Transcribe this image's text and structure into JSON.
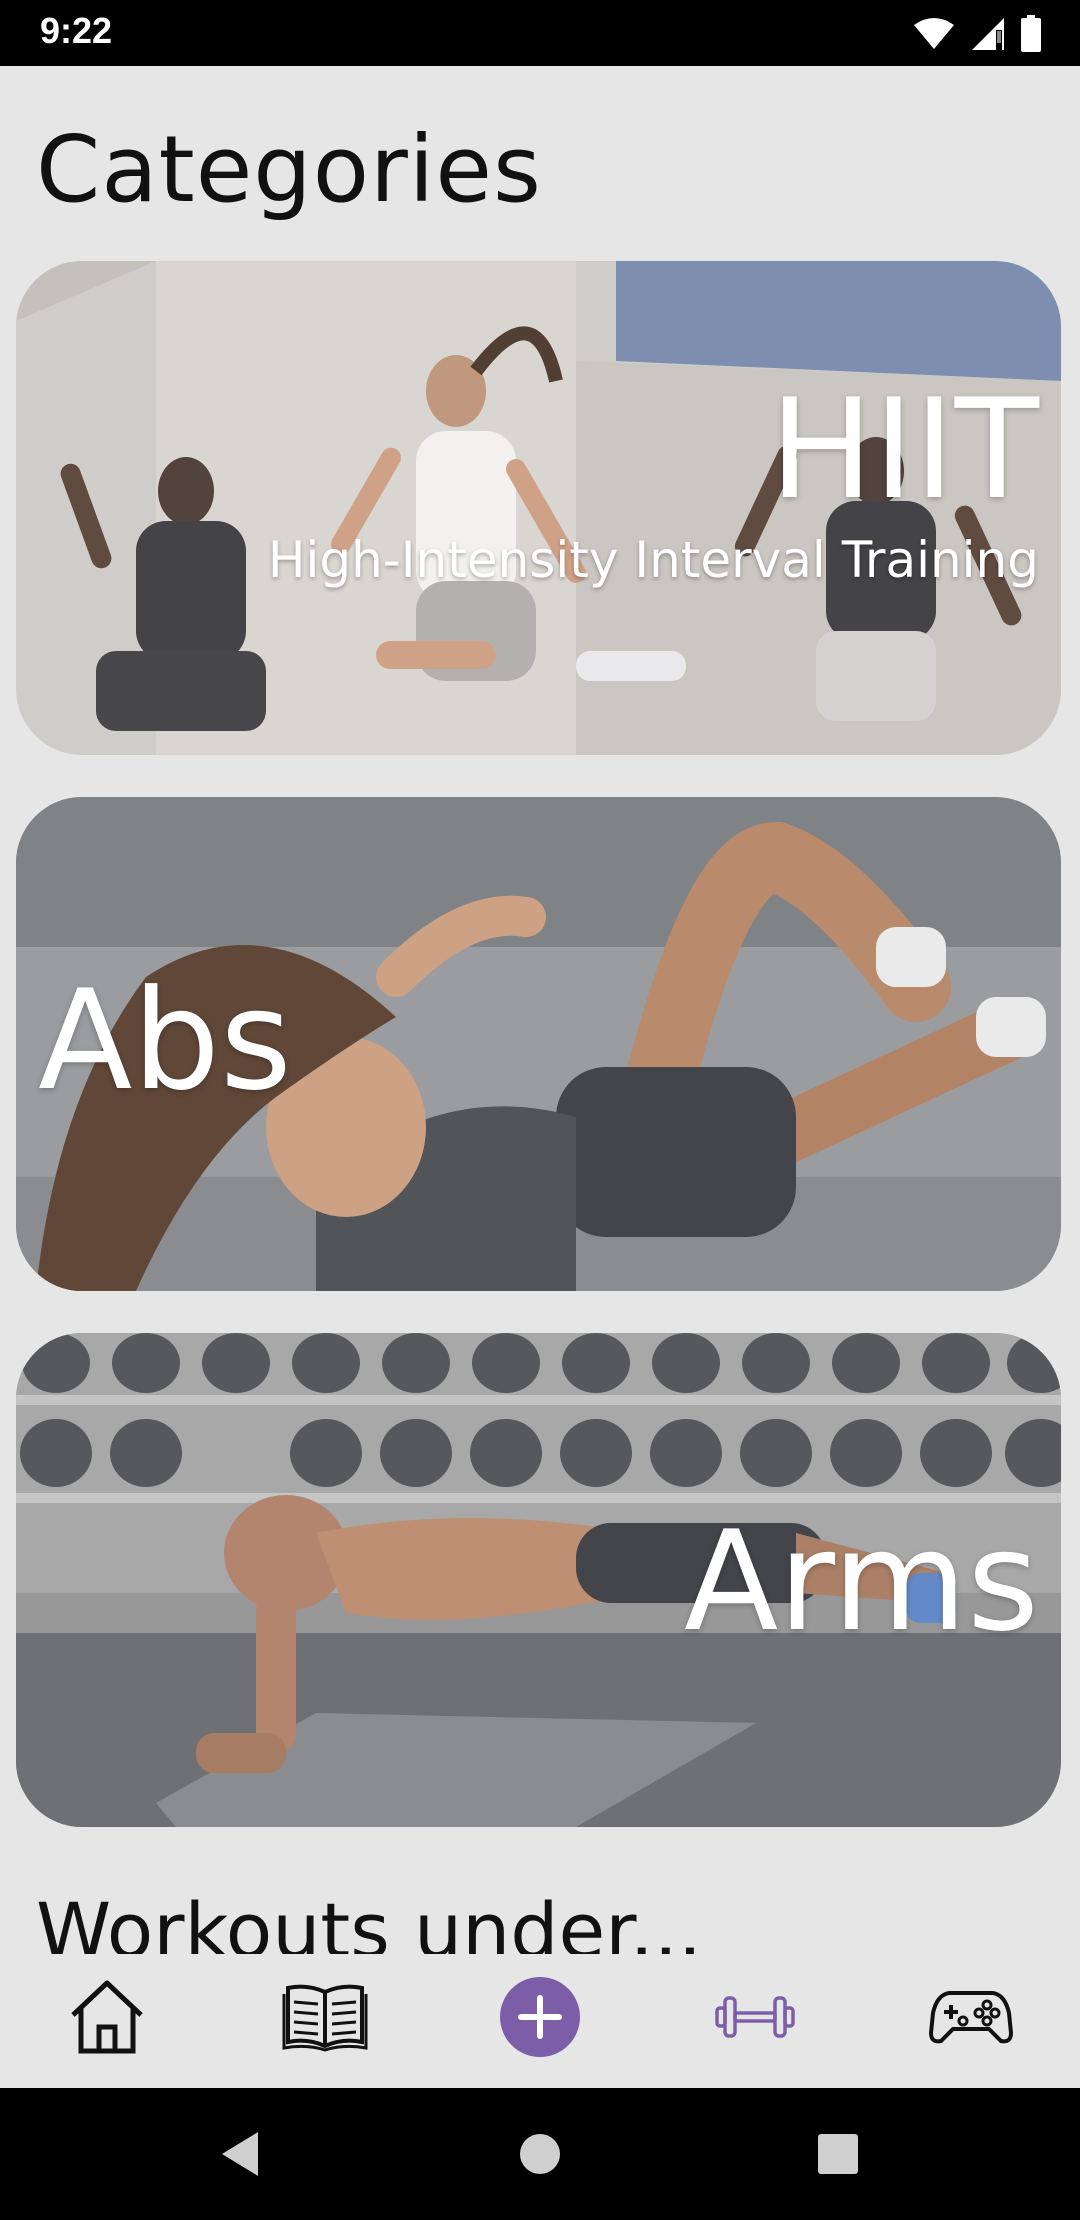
{
  "status_bar": {
    "time": "9:22"
  },
  "page": {
    "title": "Categories",
    "section_heading": "Workouts under..."
  },
  "categories": [
    {
      "title": "HIIT",
      "subtitle": "High-Intensity Interval Training"
    },
    {
      "title": "Abs"
    },
    {
      "title": "Arms"
    }
  ],
  "bottom_nav": [
    {
      "icon": "home-icon"
    },
    {
      "icon": "book-icon"
    },
    {
      "icon": "add-icon",
      "color": "#7b5ea7"
    },
    {
      "icon": "dumbbell-icon",
      "color": "#7b5ea7"
    },
    {
      "icon": "gamepad-icon"
    }
  ],
  "colors": {
    "accent": "#7b5ea7",
    "background": "#e6e6e7"
  }
}
